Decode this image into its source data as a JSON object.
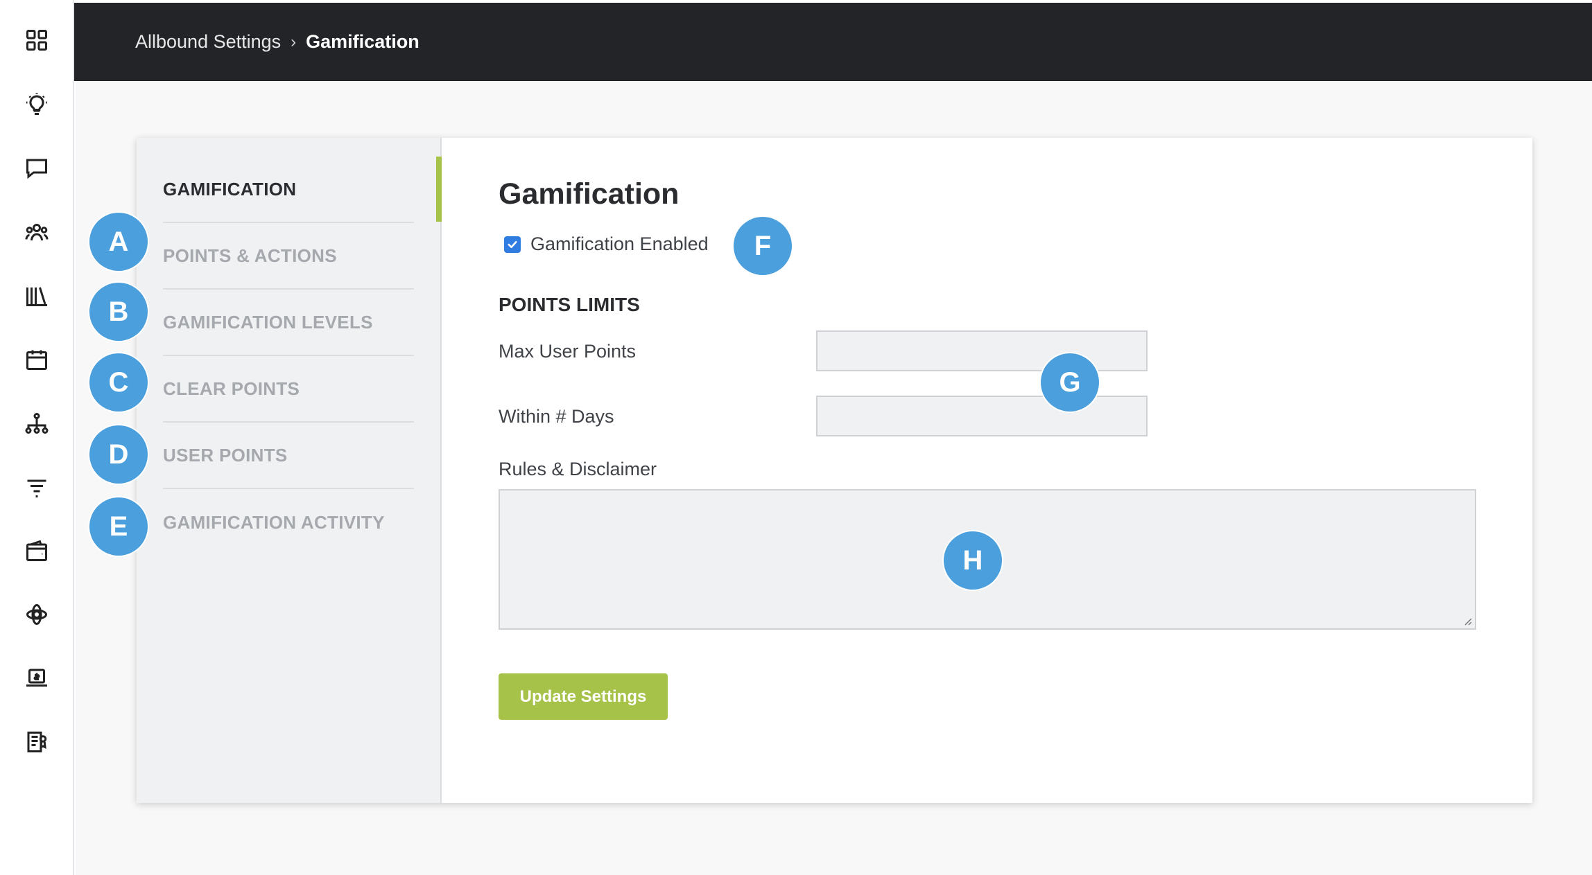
{
  "breadcrumb": {
    "root": "Allbound Settings",
    "separator": "›",
    "current": "Gamification"
  },
  "rail": {
    "icons": [
      "dashboard-grid-icon",
      "lightbulb-icon",
      "chat-icon",
      "people-icon",
      "library-icon",
      "calendar-icon",
      "org-chart-icon",
      "filter-icon",
      "wallet-icon",
      "orbit-icon",
      "laptop-dollar-icon",
      "report-icon"
    ]
  },
  "side_nav": {
    "items": [
      {
        "label": "GAMIFICATION",
        "active": true
      },
      {
        "label": "POINTS & ACTIONS",
        "active": false
      },
      {
        "label": "GAMIFICATION LEVELS",
        "active": false
      },
      {
        "label": "CLEAR POINTS",
        "active": false
      },
      {
        "label": "USER POINTS",
        "active": false
      },
      {
        "label": "GAMIFICATION ACTIVITY",
        "active": false
      }
    ]
  },
  "main": {
    "title": "Gamification",
    "enabled_label": "Gamification Enabled",
    "enabled_checked": true,
    "points_limits_title": "POINTS LIMITS",
    "max_user_points_label": "Max User Points",
    "max_user_points_value": "",
    "within_days_label": "Within # Days",
    "within_days_value": "",
    "rules_label": "Rules & Disclaimer",
    "rules_value": "",
    "update_button": "Update Settings"
  },
  "markers": [
    "A",
    "B",
    "C",
    "D",
    "E",
    "F",
    "G",
    "H"
  ],
  "colors": {
    "accent_green": "#a6c248",
    "marker_blue": "#4a9fdc",
    "header_dark": "#222428",
    "checkbox_blue": "#2f7de1"
  }
}
